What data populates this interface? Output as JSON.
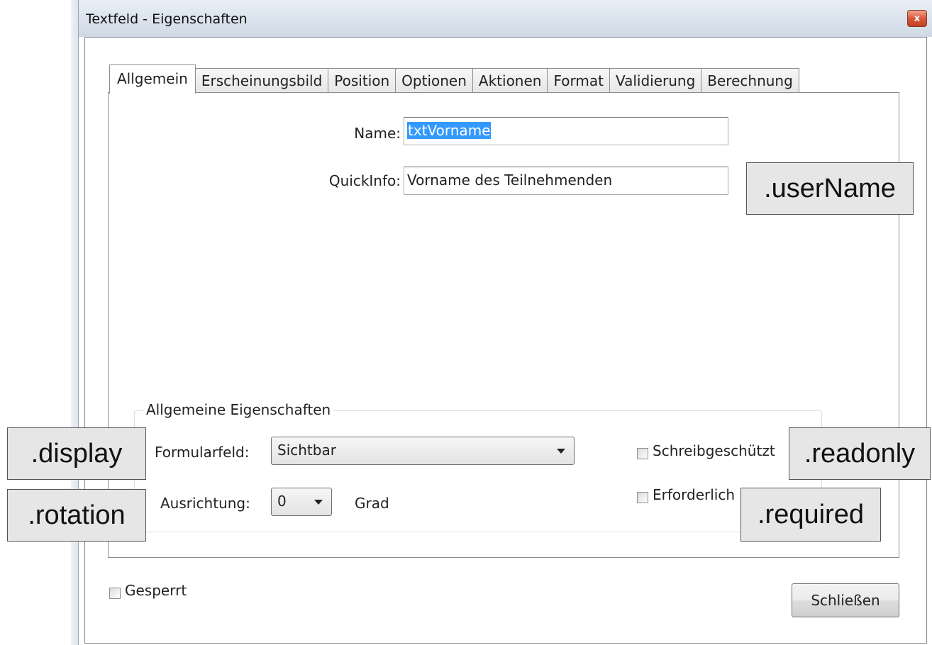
{
  "window": {
    "title": "Textfeld - Eigenschaften",
    "close_glyph": "x"
  },
  "tabs": [
    {
      "label": "Allgemein",
      "active": true
    },
    {
      "label": "Erscheinungsbild",
      "active": false
    },
    {
      "label": "Position",
      "active": false
    },
    {
      "label": "Optionen",
      "active": false
    },
    {
      "label": "Aktionen",
      "active": false
    },
    {
      "label": "Format",
      "active": false
    },
    {
      "label": "Validierung",
      "active": false
    },
    {
      "label": "Berechnung",
      "active": false
    }
  ],
  "general": {
    "name_label": "Name:",
    "name_value": "txtVorname",
    "tooltip_label": "QuickInfo:",
    "tooltip_value": "Vorname des Teilnehmenden"
  },
  "common_props": {
    "title": "Allgemeine Eigenschaften",
    "form_field_label": "Formularfeld:",
    "form_field_value": "Sichtbar",
    "orientation_label": "Ausrichtung:",
    "orientation_value": "0",
    "orientation_unit": "Grad",
    "readonly_label": "Schreibgeschützt",
    "readonly_checked": false,
    "required_label": "Erforderlich",
    "required_checked": false
  },
  "footer": {
    "locked_label": "Gesperrt",
    "locked_checked": false,
    "close_label": "Schließen"
  },
  "annotations": {
    "username": ".userName",
    "display": ".display",
    "readonly": ".readonly",
    "rotation": ".rotation",
    "required": ".required"
  }
}
